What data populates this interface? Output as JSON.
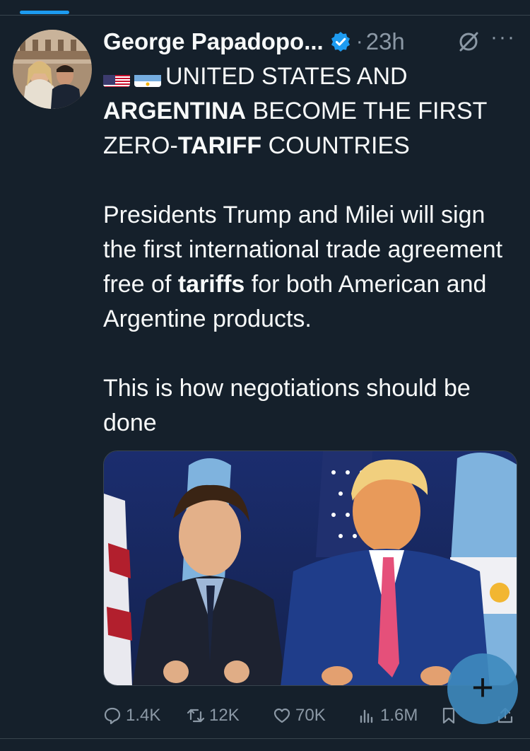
{
  "post": {
    "author_name": "George Papadopo...",
    "separator": "·",
    "timestamp": "23h",
    "more_label": "···",
    "text": {
      "line1_rest": "UNITED STATES AND",
      "line2_bold": "ARGENTINA",
      "line2_rest": " BECOME THE FIRST",
      "line3_start": "ZERO-",
      "line3_bold": "TARIFF",
      "line3_rest": " COUNTRIES",
      "para2_a": "Presidents Trump and Milei will sign the first international trade agreement free of ",
      "para2_bold": "tariffs",
      "para2_b": " for both American and Argentine products.",
      "para3": "This is how negotiations should be done"
    },
    "flags": [
      "us-flag",
      "argentina-flag"
    ]
  },
  "actions": {
    "replies": "1.4K",
    "reposts": "12K",
    "likes": "70K",
    "views": "1.6M"
  },
  "fab": {
    "label": "+"
  },
  "colors": {
    "background": "#15202b",
    "text": "#f7f9f9",
    "secondary": "#8b98a5",
    "accent": "#1d9bf0"
  }
}
